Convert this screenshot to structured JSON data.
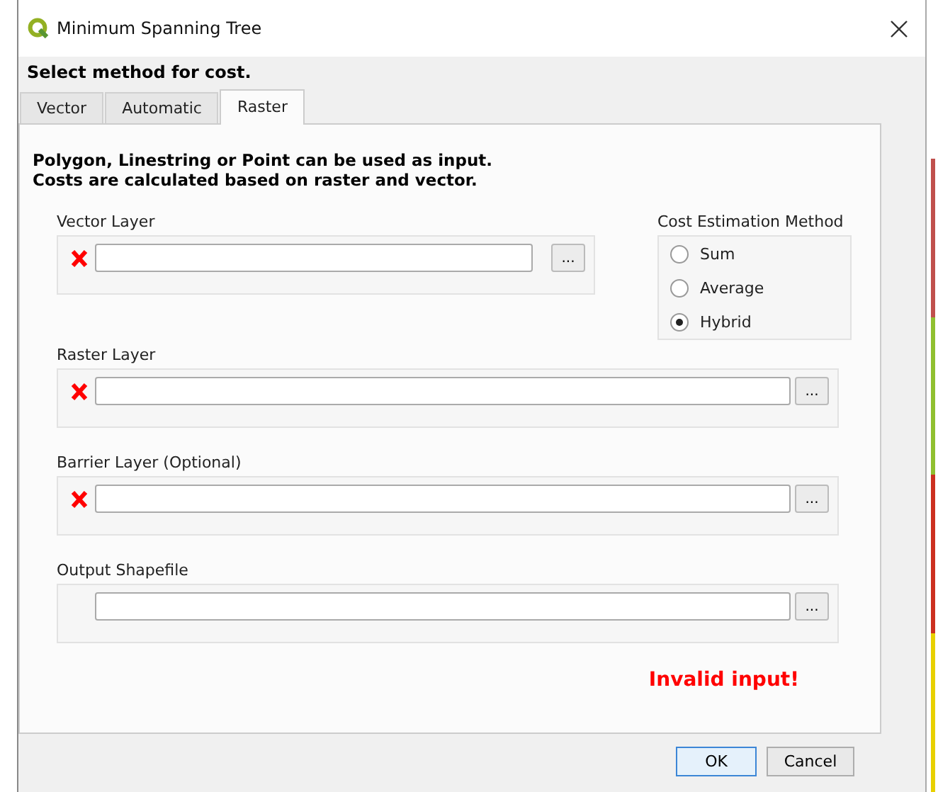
{
  "window": {
    "title": "Minimum Spanning Tree"
  },
  "heading": "Select method for cost.",
  "tabs": [
    {
      "label": "Vector",
      "selected": false
    },
    {
      "label": "Automatic",
      "selected": false
    },
    {
      "label": "Raster",
      "selected": true
    }
  ],
  "description": [
    "Polygon, Linestring or Point can be used as input.",
    "Costs are calculated based on raster and vector."
  ],
  "fields": [
    {
      "label": "Vector Layer",
      "invalid": true,
      "browse": "..."
    },
    {
      "label": "Raster Layer",
      "invalid": true,
      "browse": "..."
    },
    {
      "label": "Barrier Layer (Optional)",
      "invalid": true,
      "browse": "..."
    },
    {
      "label": "Output Shapefile",
      "invalid": false,
      "browse": "..."
    }
  ],
  "cost_method": {
    "label": "Cost Estimation Method",
    "options": [
      {
        "label": "Sum",
        "selected": false
      },
      {
        "label": "Average",
        "selected": false
      },
      {
        "label": "Hybrid",
        "selected": true
      }
    ]
  },
  "message": "Invalid input!",
  "buttons": [
    {
      "label": "OK",
      "default": true
    },
    {
      "label": "Cancel",
      "default": false
    }
  ]
}
